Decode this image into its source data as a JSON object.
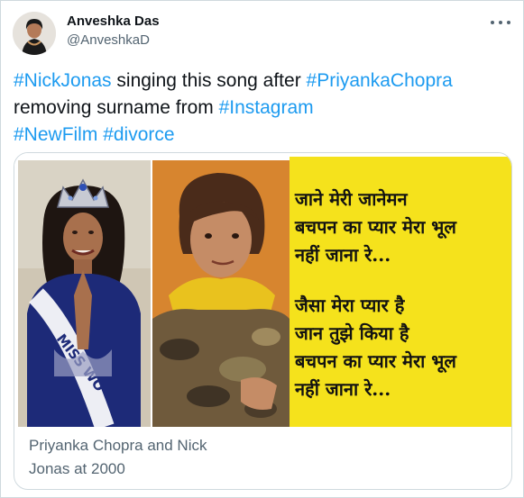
{
  "author": {
    "display_name": "Anveshka Das",
    "handle": "@AnveshkaD",
    "avatar_icon": "user-avatar-photo"
  },
  "tweet": {
    "parts": [
      {
        "text": "#NickJonas",
        "hashtag": true
      },
      {
        "text": " singing this song after ",
        "hashtag": false
      },
      {
        "text": "#PriyankaChopra",
        "hashtag": true
      },
      {
        "text": " removing surname from ",
        "hashtag": false
      },
      {
        "text": "#Instagram",
        "hashtag": true
      },
      {
        "text": "#NewFilm",
        "hashtag": true
      },
      {
        "text": " ",
        "hashtag": false
      },
      {
        "text": "#divorce",
        "hashtag": true
      }
    ]
  },
  "media": {
    "lyrics_block_1": [
      "जाने मेरी जानेमन",
      "बचपन का प्यार मेरा भूल",
      "नहीं जाना रे..."
    ],
    "lyrics_block_2": [
      "जैसा मेरा प्यार है",
      "जान तुझे किया है",
      "बचपन का प्यार मेरा भूल",
      "नहीं जाना रे..."
    ],
    "photo_text": "MISS WO",
    "caption_line_1": "Priyanka Chopra and Nick",
    "caption_line_2": "Jonas at 2000"
  },
  "colors": {
    "hashtag": "#1d9bf0",
    "text": "#0f1419",
    "secondary": "#536471",
    "lyrics_bg": "#f5e21c"
  }
}
